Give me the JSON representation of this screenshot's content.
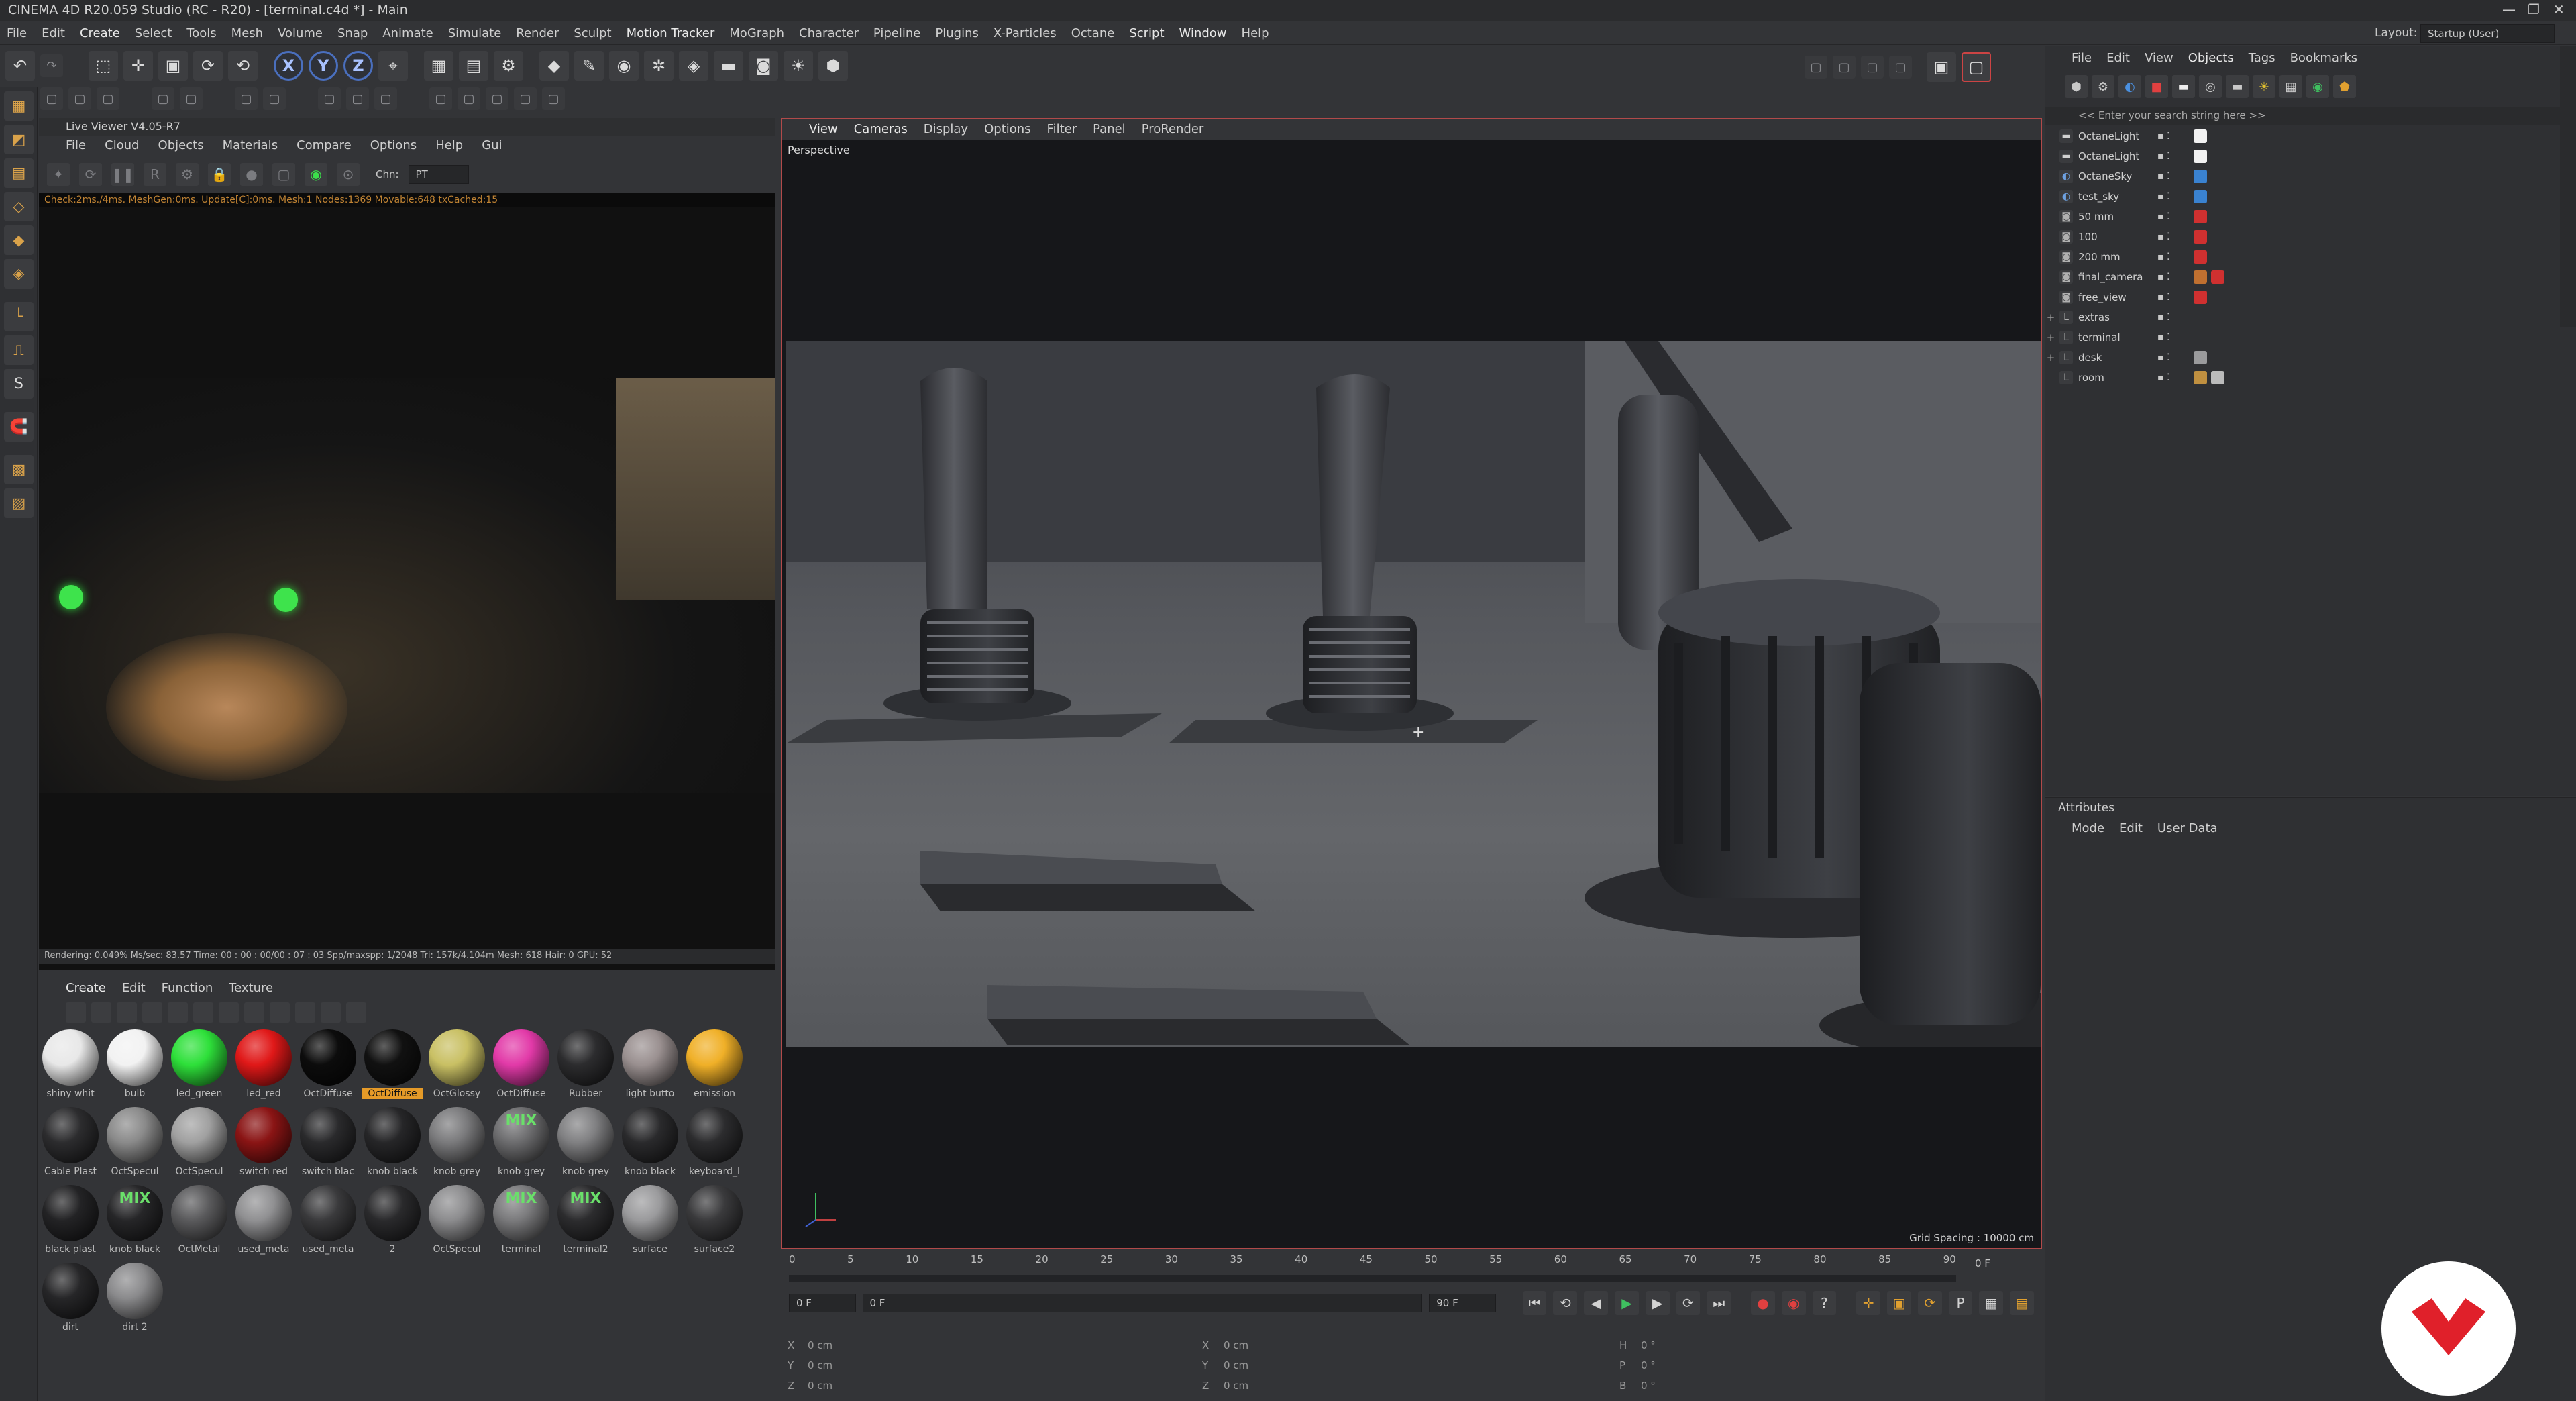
{
  "window": {
    "title": "CINEMA 4D R20.059 Studio (RC - R20) - [terminal.c4d *] - Main",
    "controls": [
      "—",
      "❐",
      "✕"
    ]
  },
  "menubar": {
    "items": [
      "File",
      "Edit",
      "Create",
      "Select",
      "Tools",
      "Mesh",
      "Volume",
      "Snap",
      "Animate",
      "Simulate",
      "Render",
      "Sculpt",
      "Motion Tracker",
      "MoGraph",
      "Character",
      "Pipeline",
      "Plugins",
      "X-Particles",
      "Octane",
      "Script",
      "Window",
      "Help"
    ],
    "layout_label": "Layout:",
    "layout_value": "Startup (User)"
  },
  "toolbar": {
    "axis_x": "X",
    "axis_y": "Y",
    "axis_z": "Z"
  },
  "liveviewer": {
    "title": "Live Viewer V4.05-R7",
    "menu": [
      "File",
      "Cloud",
      "Objects",
      "Materials",
      "Compare",
      "Options",
      "Help",
      "Gui"
    ],
    "channel_label": "Chn:",
    "channel_value": "PT",
    "status": "Check:2ms./4ms. MeshGen:0ms. Update[C]:0ms. Mesh:1 Nodes:1369 Movable:648 txCached:15",
    "render_status": "Rendering: 0.049%   Ms/sec: 83.57   Time: 00 : 00 : 00/00 : 07 : 03   Spp/maxspp: 1/2048     Tri: 157k/4.104m   Mesh: 618   Hair: 0     GPU:     52"
  },
  "materials": {
    "menu": [
      "Create",
      "Edit",
      "Function",
      "Texture"
    ],
    "items": [
      {
        "label": "shiny whit",
        "color": "#e8e8e8"
      },
      {
        "label": "bulb",
        "color": "#f2f2f2"
      },
      {
        "label": "led_green",
        "color": "#2ee03a"
      },
      {
        "label": "led_red",
        "color": "#e01818"
      },
      {
        "label": "OctDiffuse",
        "color": "#0c0c0c"
      },
      {
        "label": "OctDiffuse",
        "color": "#111111",
        "selected": true
      },
      {
        "label": "OctGlossy",
        "color": "#c9c064"
      },
      {
        "label": "OctDiffuse",
        "color": "#e23aa8"
      },
      {
        "label": "Rubber",
        "color": "#2c2c2e"
      },
      {
        "label": "light butto",
        "color": "#9a9090"
      },
      {
        "label": "emission",
        "color": "#f0b028"
      },
      {
        "label": "Cable Plast",
        "color": "#2c2c2e"
      },
      {
        "label": "OctSpecul",
        "color": "#8a8a8a"
      },
      {
        "label": "OctSpecul",
        "color": "#a0a0a0"
      },
      {
        "label": "switch red",
        "color": "#8a1414"
      },
      {
        "label": "switch blac",
        "color": "#2a2a2c"
      },
      {
        "label": "knob black",
        "color": "#262628"
      },
      {
        "label": "knob grey",
        "color": "#7a7a7c"
      },
      {
        "label": "knob grey",
        "color": "#6c6c6e",
        "mix": "MIX"
      },
      {
        "label": "knob grey",
        "color": "#808082"
      },
      {
        "label": "knob black",
        "color": "#2a2a2c"
      },
      {
        "label": "keyboard_l",
        "color": "#2c2c2e"
      },
      {
        "label": "black plast",
        "color": "#232325"
      },
      {
        "label": "knob black",
        "color": "#262628",
        "mix": "MIX"
      },
      {
        "label": "OctMetal",
        "color": "#5a5a5c"
      },
      {
        "label": "used_meta",
        "color": "#909092"
      },
      {
        "label": "used_meta",
        "color": "#3a3a3c"
      },
      {
        "label": "2",
        "color": "#2a2a2c"
      },
      {
        "label": "OctSpecul",
        "color": "#8c8c8e"
      },
      {
        "label": "terminal",
        "color": "#7a7a7c",
        "mix": "MIX"
      },
      {
        "label": "terminal2",
        "color": "#2c2c2e",
        "mix": "MIX"
      },
      {
        "label": "surface",
        "color": "#9a9a9c"
      },
      {
        "label": "surface2",
        "color": "#3a3a3c"
      },
      {
        "label": "dirt",
        "color": "#262628"
      },
      {
        "label": "dirt 2",
        "color": "#8a8a8c"
      }
    ]
  },
  "viewport": {
    "menu": [
      "View",
      "Cameras",
      "Display",
      "Options",
      "Filter",
      "Panel",
      "ProRender"
    ],
    "camera": "Perspective",
    "grid_spacing": "Grid Spacing : 10000 cm"
  },
  "timeline": {
    "ticks": [
      "0",
      "5",
      "10",
      "15",
      "20",
      "25",
      "30",
      "35",
      "40",
      "45",
      "50",
      "55",
      "60",
      "65",
      "70",
      "75",
      "80",
      "85",
      "90"
    ],
    "current_frame_right": "0 F",
    "start_field": "0 F",
    "current_field": "0 F",
    "end_field": "90 F",
    "end_field2": "90 F"
  },
  "coords": {
    "rows": [
      {
        "a": "X",
        "av": "0 cm",
        "b": "X",
        "bv": "0 cm",
        "c": "H",
        "cv": "0 °"
      },
      {
        "a": "Y",
        "av": "0 cm",
        "b": "Y",
        "bv": "0 cm",
        "c": "P",
        "cv": "0 °"
      },
      {
        "a": "Z",
        "av": "0 cm",
        "b": "Z",
        "bv": "0 cm",
        "c": "B",
        "cv": "0 °"
      }
    ]
  },
  "objects": {
    "menu": [
      "File",
      "Edit",
      "View",
      "Objects",
      "Tags",
      "Bookmarks"
    ],
    "search_placeholder": "<< Enter your search string here >>",
    "rows": [
      {
        "name": "OctaneLight",
        "icon": "light-icon",
        "icolor": "#d0d0d0",
        "tags": [
          "#f2f2f2"
        ]
      },
      {
        "name": "OctaneLight",
        "icon": "light-icon",
        "icolor": "#d0d0d0",
        "tags": [
          "#f2f2f2"
        ]
      },
      {
        "name": "OctaneSky",
        "icon": "sky-icon",
        "icolor": "#6da0e0",
        "tags": [
          "#3a82d0"
        ]
      },
      {
        "name": "test_sky",
        "icon": "sky-icon",
        "icolor": "#6da0e0",
        "tags": [
          "#3a82d0"
        ]
      },
      {
        "name": "50 mm",
        "icon": "camera-icon",
        "icolor": "#b0b0b0",
        "tags": [
          "#d03030"
        ]
      },
      {
        "name": "100",
        "icon": "camera-icon",
        "icolor": "#b0b0b0",
        "tags": [
          "#d03030"
        ]
      },
      {
        "name": "200 mm",
        "icon": "camera-icon",
        "icolor": "#b0b0b0",
        "tags": [
          "#d03030"
        ]
      },
      {
        "name": "final_camera",
        "icon": "camera-icon",
        "icolor": "#b0b0b0",
        "tags": [
          "#c07030",
          "#d03030"
        ]
      },
      {
        "name": "free_view",
        "icon": "camera-icon",
        "icolor": "#b0b0b0",
        "tags": [
          "#d03030"
        ]
      },
      {
        "name": "extras",
        "icon": "null-icon",
        "icolor": "#b0b0b0",
        "tags": [],
        "expand": "+"
      },
      {
        "name": "terminal",
        "icon": "null-icon",
        "icolor": "#b0b0b0",
        "tags": [],
        "expand": "+"
      },
      {
        "name": "desk",
        "icon": "null-icon",
        "icolor": "#b0b0b0",
        "tags": [
          "#9a9a9c"
        ],
        "expand": "+"
      },
      {
        "name": "room",
        "icon": "null-icon",
        "icolor": "#b0b0b0",
        "tags": [
          "#c09040",
          "#bbbbbb"
        ]
      }
    ]
  },
  "attributes": {
    "title": "Attributes",
    "menu": [
      "Mode",
      "Edit",
      "User Data"
    ]
  },
  "logo": {
    "color": "#e0202a"
  }
}
